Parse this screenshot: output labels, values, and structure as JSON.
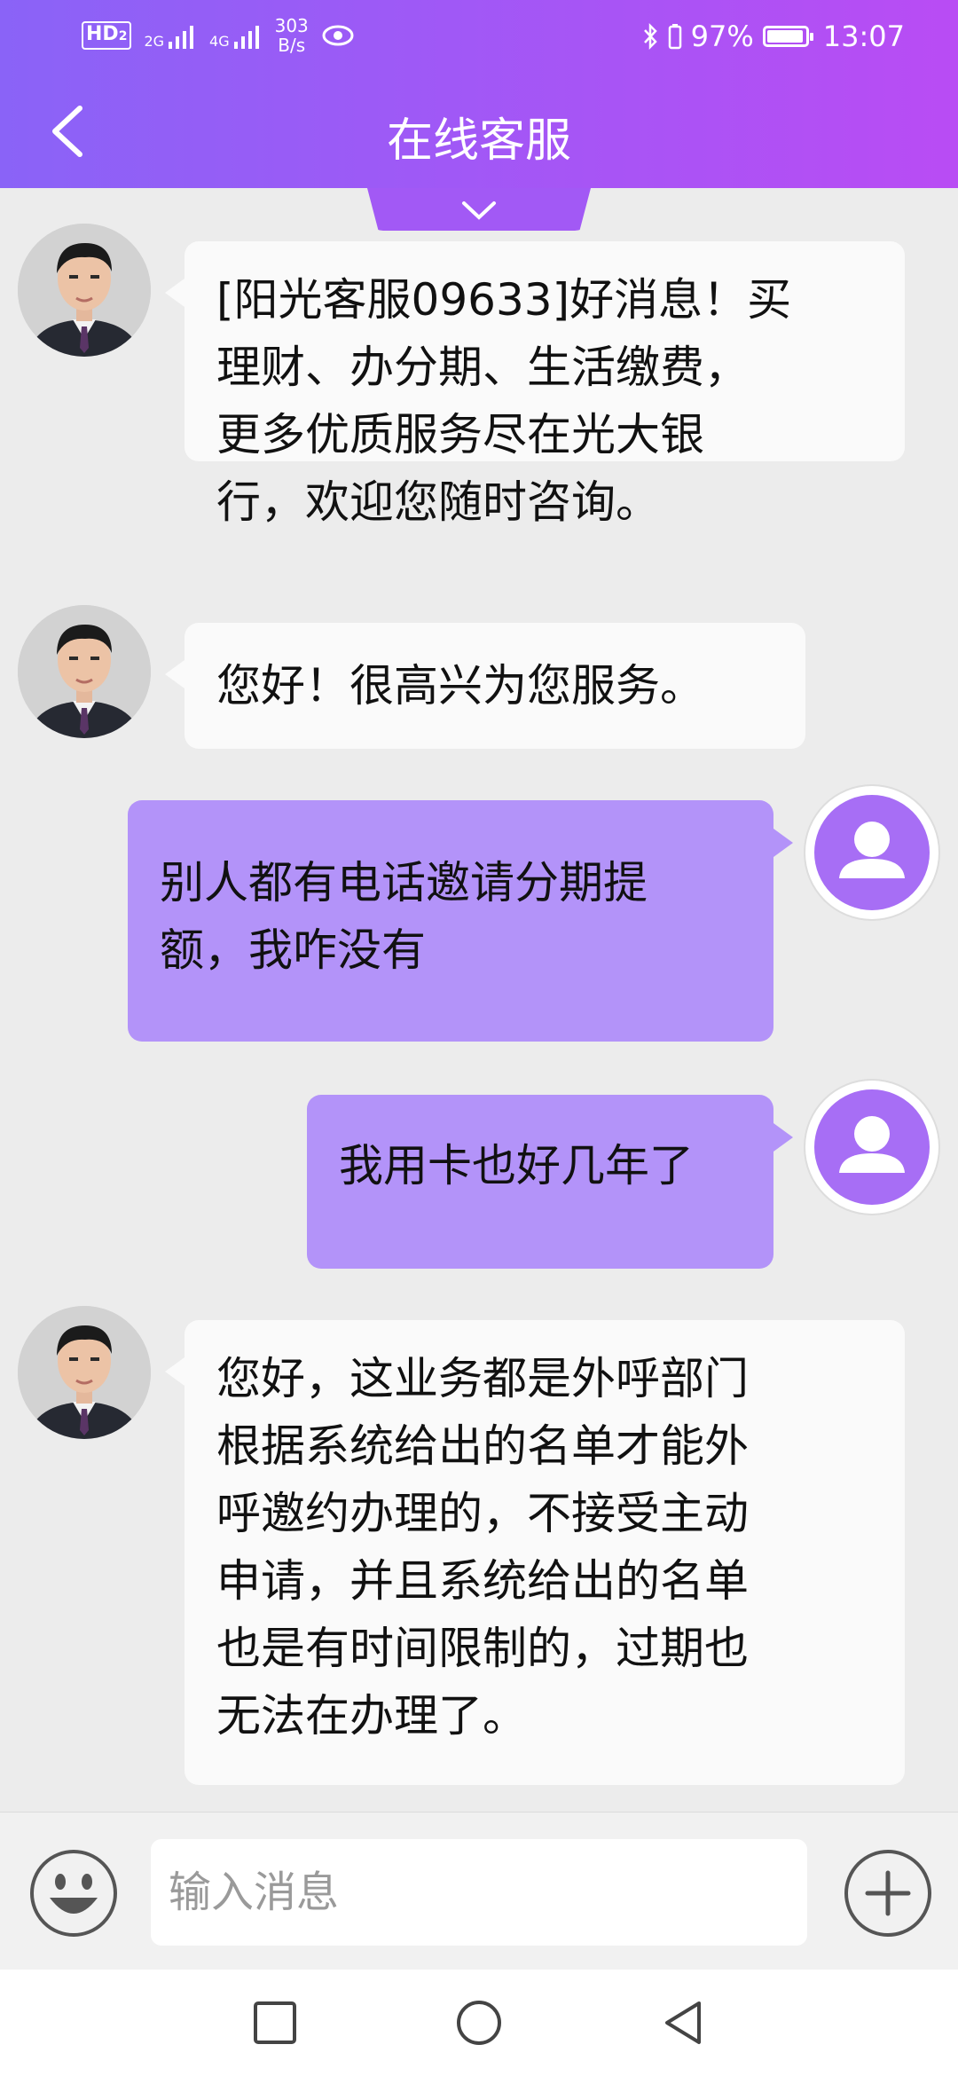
{
  "status_bar": {
    "hd": "HD",
    "hd_sub": "2",
    "net1": "2G",
    "net2": "4G",
    "speed_value": "303",
    "speed_unit": "B/s",
    "battery": "97%",
    "battery_level": 0.97,
    "time": "13:07"
  },
  "header": {
    "title": "在线客服"
  },
  "messages": [
    {
      "from": "agent",
      "text": "[阳光客服09633]好消息！买\n理财、办分期、生活缴费，\n更多优质服务尽在光大银\n行，欢迎您随时咨询。"
    },
    {
      "from": "agent",
      "text": "您好！很高兴为您服务。"
    },
    {
      "from": "user",
      "text": "别人都有电话邀请分期提\n额，我咋没有"
    },
    {
      "from": "user",
      "text": "我用卡也好几年了"
    },
    {
      "from": "agent",
      "text": "您好，这业务都是外呼部门\n根据系统给出的名单才能外\n呼邀约办理的，不接受主动\n申请，并且系统给出的名单\n也是有时间限制的，过期也\n无法在办理了。"
    }
  ],
  "input": {
    "placeholder": "输入消息"
  },
  "colors": {
    "header_start": "#8a63f7",
    "header_end": "#b94cf4",
    "user_bubble": "#b393f9",
    "user_avatar": "#a76ef5",
    "agent_bubble": "#fafafa",
    "chat_bg": "#ececec"
  },
  "icons": {
    "back": "back-icon",
    "expand": "chevron-down-icon",
    "emoji": "smiley-icon",
    "plus": "plus-icon",
    "nav_recent": "square-icon",
    "nav_home": "circle-icon",
    "nav_back": "triangle-back-icon"
  }
}
